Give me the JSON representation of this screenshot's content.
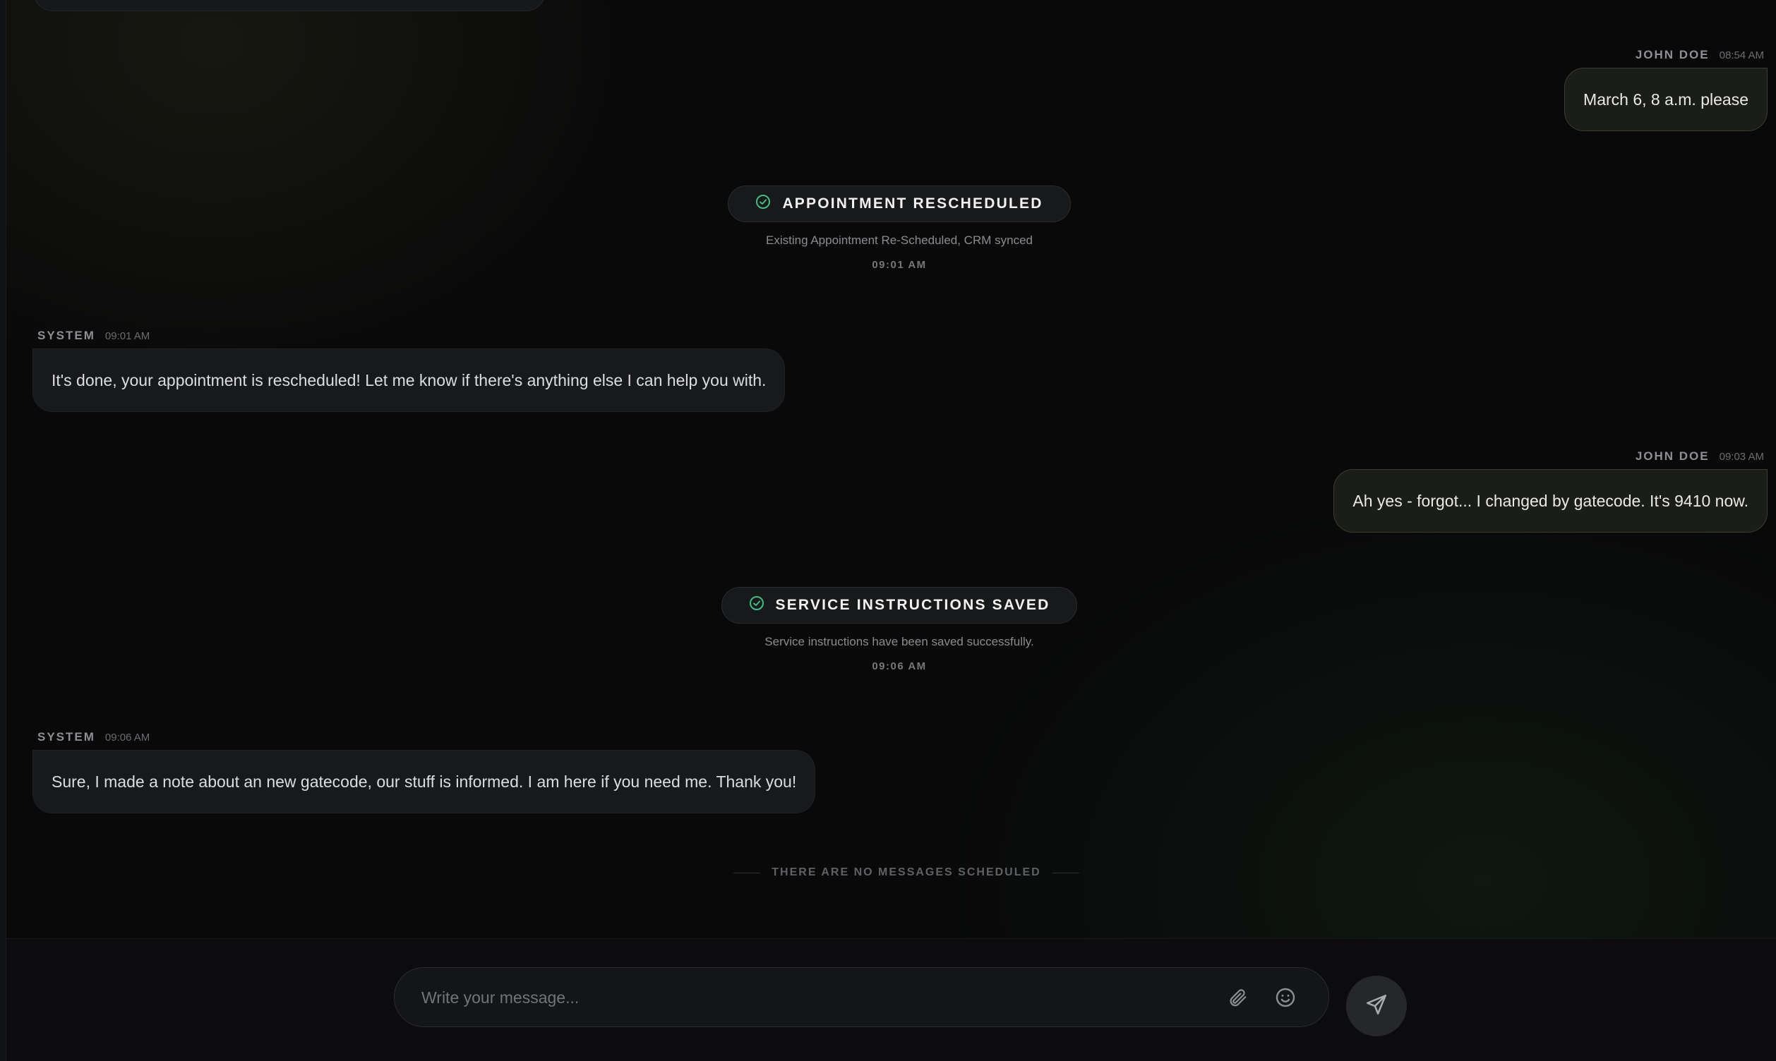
{
  "messages": [
    {
      "sender": "JOHN DOE",
      "time": "08:54 AM",
      "text": "March 6, 8 a.m. please"
    },
    {
      "sender": "SYSTEM",
      "time": "09:01 AM",
      "text": "It's done, your appointment is rescheduled! Let me know if there's anything else I can help you with."
    },
    {
      "sender": "JOHN DOE",
      "time": "09:03 AM",
      "text": "Ah yes - forgot... I changed by gatecode. It's 9410 now."
    },
    {
      "sender": "SYSTEM",
      "time": "09:06 AM",
      "text": "Sure, I made a note about an new gatecode, our stuff is informed. I am here if you need me. Thank you!"
    }
  ],
  "events": [
    {
      "title": "APPOINTMENT RESCHEDULED",
      "description": "Existing Appointment Re-Scheduled, CRM synced",
      "time": "09:01 AM",
      "icon": "check-circle-icon"
    },
    {
      "title": "SERVICE INSTRUCTIONS SAVED",
      "description": "Service instructions have been saved successfully.",
      "time": "09:06 AM",
      "icon": "check-circle-icon"
    }
  ],
  "divider": {
    "text": "THERE ARE NO MESSAGES SCHEDULED"
  },
  "composer": {
    "placeholder": "Write your message...",
    "value": "",
    "attach_icon": "paperclip-icon",
    "emoji_icon": "smiley-icon",
    "send_icon": "send-icon"
  },
  "colors": {
    "background": "#09090a",
    "user_bubble": "#1b1d18",
    "system_bubble": "#18191c",
    "success_accent": "#3fbf7f"
  }
}
